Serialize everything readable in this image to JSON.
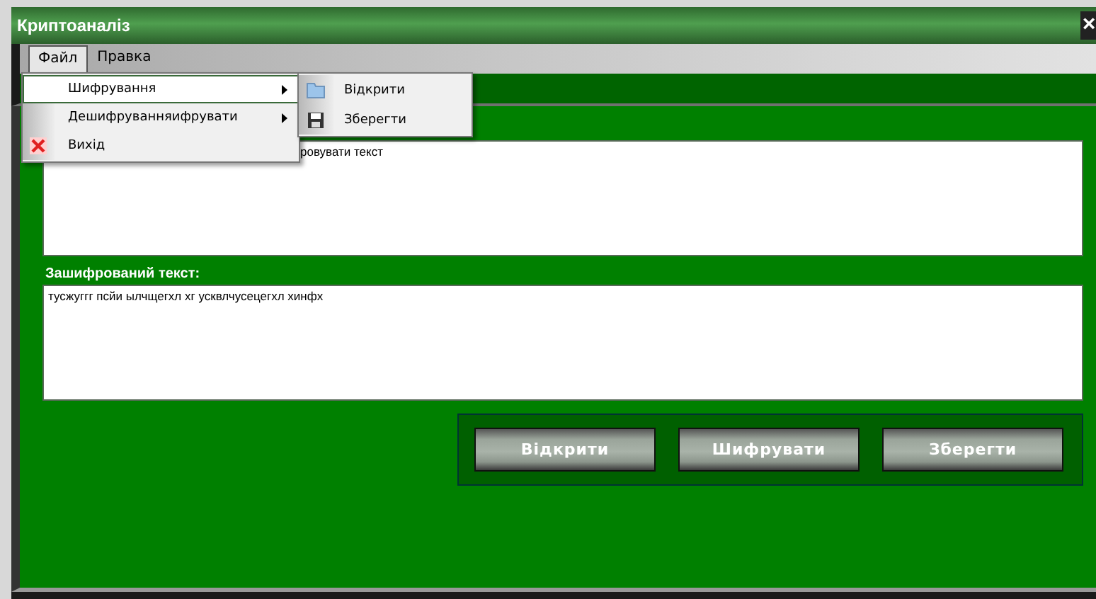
{
  "window": {
    "title": "Криптоаналіз",
    "close": "×"
  },
  "menu_bar": [
    {
      "label": "Файл",
      "selected": true
    },
    {
      "label": "Правка",
      "selected": false
    }
  ],
  "menu": [
    {
      "label": "Шифрування",
      "selected": true,
      "kind": "submenu"
    },
    {
      "label": "Дешифруванняифрувати",
      "selected": false,
      "kind": "submenu"
    },
    {
      "label": "Вихід",
      "selected": false,
      "kind": "exit"
    }
  ],
  "submenu": [
    {
      "label": "Відкрити",
      "kind": "open"
    },
    {
      "label": "Зберегти",
      "kind": "save"
    }
  ],
  "plain_text": {
    "value": "ровувати текст"
  },
  "cipher_text": {
    "label": "Зашифрований текст:",
    "value": "тусжуггг псйи ылчщегхл хг усквлчусецегхл хинфх"
  },
  "buttons": [
    "Відкрити",
    "Шифрувати",
    "Зберегти"
  ]
}
